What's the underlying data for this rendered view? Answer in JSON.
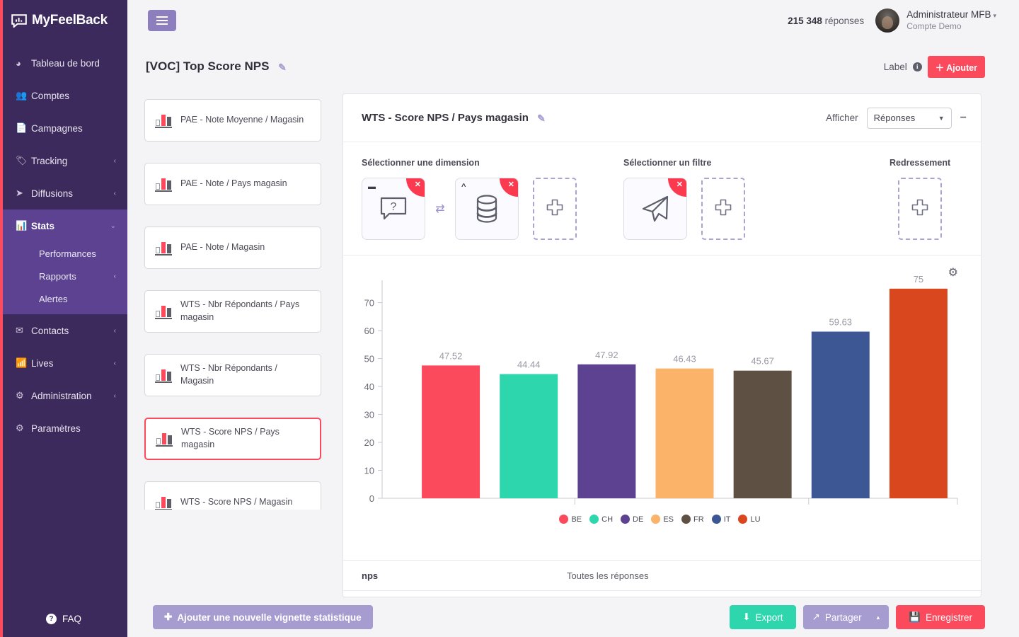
{
  "brand": {
    "name": "MyFeelBack",
    "logo_icon": "speech-bubble-chart-icon"
  },
  "sidebar": {
    "items": [
      {
        "label": "Tableau de bord",
        "icon": "dashboard-icon",
        "chevron": ""
      },
      {
        "label": "Comptes",
        "icon": "users-icon",
        "chevron": ""
      },
      {
        "label": "Campagnes",
        "icon": "file-icon",
        "chevron": ""
      },
      {
        "label": "Tracking",
        "icon": "tag-icon",
        "chevron": "‹"
      },
      {
        "label": "Diffusions",
        "icon": "paper-plane-icon",
        "chevron": "‹"
      }
    ],
    "stats_group": {
      "label": "Stats",
      "icon": "bar-chart-icon",
      "chevron": "⌄",
      "sub_items": [
        {
          "label": "Performances",
          "chevron": ""
        },
        {
          "label": "Rapports",
          "chevron": "‹"
        },
        {
          "label": "Alertes",
          "chevron": ""
        }
      ]
    },
    "items_after": [
      {
        "label": "Contacts",
        "icon": "envelope-icon",
        "chevron": "‹"
      },
      {
        "label": "Lives",
        "icon": "rss-icon",
        "chevron": "‹"
      },
      {
        "label": "Administration",
        "icon": "cogs-icon",
        "chevron": "‹"
      },
      {
        "label": "Paramètres",
        "icon": "gear-icon",
        "chevron": ""
      }
    ],
    "faq": {
      "label": "FAQ",
      "icon": "question-circle-icon"
    }
  },
  "topbar": {
    "menu_icon": "hamburger-icon",
    "responses_count": "215 348",
    "responses_label": "réponses",
    "user_name": "Administrateur MFB",
    "user_account": "Compte Demo",
    "user_caret": "▾"
  },
  "pagehead": {
    "title": "[VOC] Top Score NPS",
    "edit_icon": "pencil-icon",
    "label_text": "Label",
    "info_icon": "info-icon",
    "add_button": "＋ Ajouter"
  },
  "vignettes": [
    {
      "label": "PAE - Note Moyenne / Magasin",
      "selected": false
    },
    {
      "label": "PAE - Note / Pays magasin",
      "selected": false
    },
    {
      "label": "PAE - Note / Magasin",
      "selected": false
    },
    {
      "label": "WTS - Nbr Répondants / Pays magasin",
      "selected": false
    },
    {
      "label": "WTS - Nbr Répondants / Magasin",
      "selected": false
    },
    {
      "label": "WTS - Score NPS / Pays magasin",
      "selected": true
    },
    {
      "label": "WTS - Score NPS / Magasin",
      "selected": false
    }
  ],
  "card": {
    "title": "WTS - Score NPS / Pays magasin",
    "edit_icon": "pencil-icon",
    "afficher_label": "Afficher",
    "afficher_value": "Réponses",
    "collapse_icon": "minus-icon",
    "settings_icon": "gear-icon"
  },
  "selectors": {
    "dimension_title": "Sélectionner une dimension",
    "filter_title": "Sélectionner un filtre",
    "redressement_title": "Redressement",
    "dimension_tiles": [
      {
        "icon": "question-bubble-icon",
        "corner": "—",
        "closable": true
      },
      {
        "icon": "database-icon",
        "corner": "⌃",
        "closable": true
      }
    ],
    "dimension_add": "plus-icon",
    "filter_tiles": [
      {
        "icon": "paper-plane-icon",
        "corner": "",
        "closable": true
      }
    ],
    "filter_add": "plus-icon",
    "redressement_add": "plus-icon",
    "swap_icon": "swap-arrows-icon"
  },
  "table_row": {
    "key": "nps",
    "value": "Toutes les réponses"
  },
  "footer": {
    "add_vignette": "Ajouter une nouvelle vignette statistique",
    "add_icon": "plus-icon",
    "export": "Export",
    "export_icon": "download-icon",
    "share": "Partager",
    "share_icon": "share-icon",
    "share_caret": "▴",
    "save": "Enregistrer",
    "save_icon": "floppy-icon"
  },
  "chart_data": {
    "type": "bar",
    "title": "",
    "categories": [
      "BE",
      "CH",
      "DE",
      "ES",
      "FR",
      "IT",
      "LU"
    ],
    "values": [
      47.52,
      44.44,
      47.92,
      46.43,
      45.67,
      59.63,
      75
    ],
    "value_labels": [
      "47.52",
      "44.44",
      "47.92",
      "46.43",
      "45.67",
      "59.63",
      "75"
    ],
    "colors": [
      "#fb4a5c",
      "#2ed6ae",
      "#5c4291",
      "#fbb269",
      "#5e5144",
      "#3d5795",
      "#d9471f"
    ],
    "legend": [
      "BE",
      "CH",
      "DE",
      "ES",
      "FR",
      "IT",
      "LU"
    ],
    "legend_position": "bottom",
    "yticks": [
      0,
      10,
      20,
      30,
      40,
      50,
      60,
      70
    ],
    "ylim": [
      0,
      75
    ],
    "xlabel": "",
    "ylabel": "",
    "grid": false
  }
}
